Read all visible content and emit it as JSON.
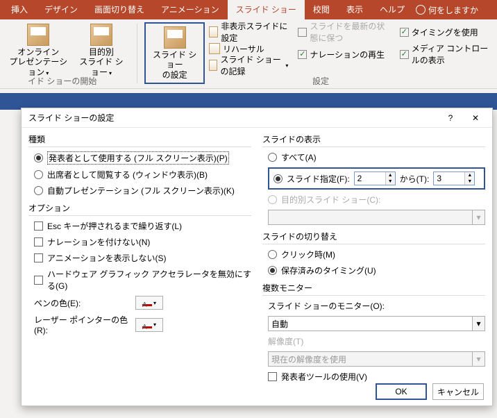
{
  "tabs": [
    "挿入",
    "デザイン",
    "画面切り替え",
    "アニメーション",
    "スライド ショー",
    "校閲",
    "表示",
    "ヘルプ"
  ],
  "tell_me": "何をしますか",
  "ribbon": {
    "online": {
      "l1": "オンライン",
      "l2": "プレゼンテーション"
    },
    "custom_show": {
      "l1": "目的別",
      "l2": "スライド ショー"
    },
    "setup": {
      "l1": "スライド ショー",
      "l2": "の設定"
    },
    "hide_slide": "非表示スライドに設定",
    "rehearse": "リハーサル",
    "record": "スライド ショーの記録",
    "keep_current": "スライドを最新の状態に保つ",
    "use_timing": "タイミングを使用",
    "play_narration": "ナレーションの再生",
    "media_ctrl": "メディア コントロールの表示",
    "group_start": "イド ショーの開始",
    "group_settings": "設定"
  },
  "dialog": {
    "title": "スライド ショーの設定",
    "kind": {
      "heading": "種類",
      "presenter": "発表者として使用する (フル スクリーン表示)(P)",
      "attendee": "出席者として閲覧する (ウィンドウ表示)(B)",
      "auto": "自動プレゼンテーション (フル スクリーン表示)(K)"
    },
    "options": {
      "heading": "オプション",
      "loop": "Esc キーが押されるまで繰り返す(L)",
      "no_narration": "ナレーションを付けない(N)",
      "no_anim": "アニメーションを表示しない(S)",
      "no_hwaccel": "ハードウェア グラフィック アクセラレータを無効にする(G)",
      "pen_color": "ペンの色(E):",
      "laser_color": "レーザー ポインターの色(R):"
    },
    "show": {
      "heading": "スライドの表示",
      "all": "すべて(A)",
      "range": "スライド指定(F):",
      "to": "から(T):",
      "from_v": "2",
      "to_v": "3",
      "custom": "目的別スライド ショー(C):"
    },
    "advance": {
      "heading": "スライドの切り替え",
      "click": "クリック時(M)",
      "saved": "保存済みのタイミング(U)"
    },
    "monitor": {
      "heading": "複数モニター",
      "monitor_label": "スライド ショーのモニター(O):",
      "monitor_v": "自動",
      "res_label": "解像度(T)",
      "res_v": "現在の解像度を使用",
      "presenter_tools": "発表者ツールの使用(V)"
    },
    "ok": "OK",
    "cancel": "キャンセル"
  }
}
